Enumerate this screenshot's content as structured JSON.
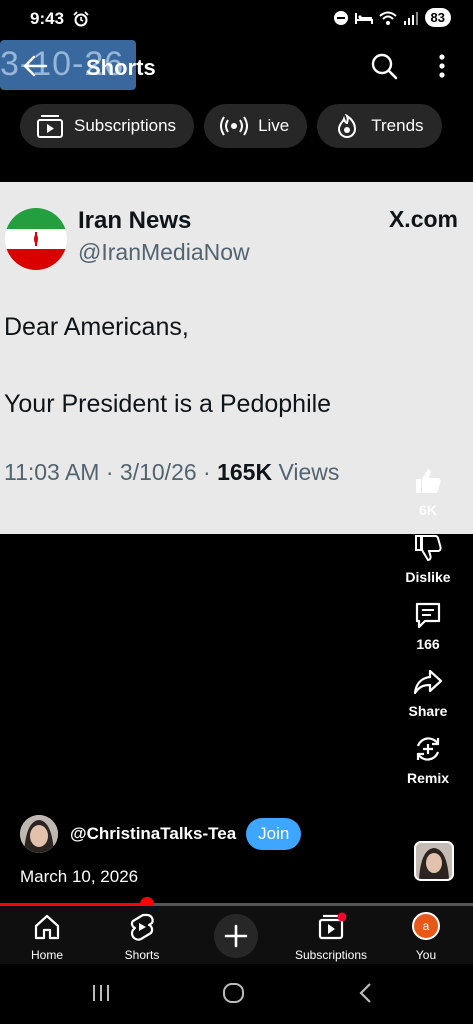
{
  "status": {
    "time": "9:43",
    "battery": "83"
  },
  "header": {
    "overlay_text": "3-10-26",
    "title": "Shorts"
  },
  "chips": [
    {
      "label": "Subscriptions",
      "icon": "subscriptions-icon"
    },
    {
      "label": "Live",
      "icon": "live-icon"
    },
    {
      "label": "Trends",
      "icon": "trends-icon"
    }
  ],
  "tweet": {
    "name": "Iran News",
    "handle": "@IranMediaNow",
    "source": "X.com",
    "line1": "Dear Americans,",
    "line2": "Your President is a Pedophile",
    "time_date": "11:03 AM · 3/10/26 · ",
    "views_count": "165K",
    "views_label": " Views"
  },
  "actions": {
    "like_count": "6K",
    "dislike_label": "Dislike",
    "comment_count": "166",
    "share_label": "Share",
    "remix_label": "Remix"
  },
  "channel": {
    "name": "@ChristinaTalks-Tea",
    "join_label": "Join",
    "date": "March 10, 2026"
  },
  "playback": {
    "progress_fraction": 0.31
  },
  "bottom_nav": {
    "home": "Home",
    "shorts": "Shorts",
    "subscriptions": "Subscriptions",
    "you": "You",
    "you_initial": "a"
  },
  "colors": {
    "accent_red": "#ff0000",
    "join_blue": "#3ea6ff",
    "card_bg": "#e9e9e9"
  }
}
